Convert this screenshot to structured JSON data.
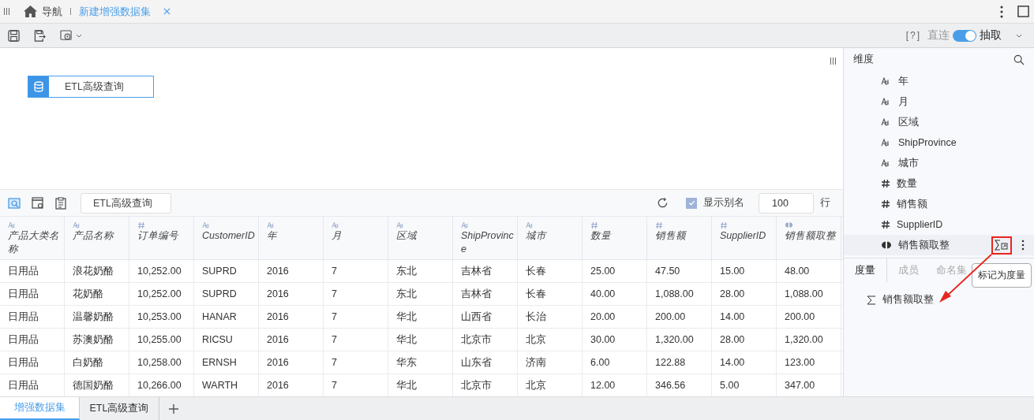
{
  "top_bar": {
    "nav_label": "导航",
    "tabs": [
      {
        "label": "新建增强数据集",
        "selected": true
      }
    ]
  },
  "toolbar": {
    "help": "[?]",
    "mode_left": "直连",
    "mode_on": true,
    "mode_right": "抽取"
  },
  "canvas": {
    "nodes": [
      {
        "label": "ETL高级查询"
      }
    ]
  },
  "preview_toolbar": {
    "node_name": "ETL高级查询",
    "show_alias": {
      "label": "显示别名",
      "checked": true
    },
    "row_limit": "100",
    "row_unit": "行"
  },
  "table": {
    "columns": [
      {
        "kind": "text",
        "label": "产品大类名称"
      },
      {
        "kind": "text",
        "label": "产品名称"
      },
      {
        "kind": "number",
        "label": "订单编号"
      },
      {
        "kind": "text",
        "label": "CustomerID"
      },
      {
        "kind": "text",
        "label": "年"
      },
      {
        "kind": "text",
        "label": "月"
      },
      {
        "kind": "text",
        "label": "区域"
      },
      {
        "kind": "text",
        "label": "ShipProvince"
      },
      {
        "kind": "text",
        "label": "城市"
      },
      {
        "kind": "number",
        "label": "数量"
      },
      {
        "kind": "number",
        "label": "销售额"
      },
      {
        "kind": "number",
        "label": "SupplierID"
      },
      {
        "kind": "calculated",
        "label": "销售额取整"
      }
    ],
    "rows": [
      [
        "日用品",
        "浪花奶酪",
        "10,252.00",
        "SUPRD",
        "2016",
        "7",
        "东北",
        "吉林省",
        "长春",
        "25.00",
        "47.50",
        "15.00",
        "48.00"
      ],
      [
        "日用品",
        "花奶酪",
        "10,252.00",
        "SUPRD",
        "2016",
        "7",
        "东北",
        "吉林省",
        "长春",
        "40.00",
        "1,088.00",
        "28.00",
        "1,088.00"
      ],
      [
        "日用品",
        "温馨奶酪",
        "10,253.00",
        "HANAR",
        "2016",
        "7",
        "华北",
        "山西省",
        "长治",
        "20.00",
        "200.00",
        "14.00",
        "200.00"
      ],
      [
        "日用品",
        "苏澳奶酪",
        "10,255.00",
        "RICSU",
        "2016",
        "7",
        "华北",
        "北京市",
        "北京",
        "30.00",
        "1,320.00",
        "28.00",
        "1,320.00"
      ],
      [
        "日用品",
        "白奶酪",
        "10,258.00",
        "ERNSH",
        "2016",
        "7",
        "华东",
        "山东省",
        "济南",
        "6.00",
        "122.88",
        "14.00",
        "123.00"
      ],
      [
        "日用品",
        "德国奶酪",
        "10,266.00",
        "WARTH",
        "2016",
        "7",
        "华北",
        "北京市",
        "北京",
        "12.00",
        "346.56",
        "5.00",
        "347.00"
      ]
    ]
  },
  "bottom_tabs": [
    {
      "label": "增强数据集",
      "selected": true
    },
    {
      "label": "ETL高级查询",
      "selected": false
    }
  ],
  "dimensions": {
    "title": "维度",
    "items": [
      {
        "kind": "text",
        "label": "年",
        "selected": false
      },
      {
        "kind": "text",
        "label": "月",
        "selected": false
      },
      {
        "kind": "text",
        "label": "区域",
        "selected": false
      },
      {
        "kind": "text",
        "label": "ShipProvince",
        "selected": false
      },
      {
        "kind": "text",
        "label": "城市",
        "selected": false
      },
      {
        "kind": "number",
        "label": "数量",
        "selected": false
      },
      {
        "kind": "number",
        "label": "销售额",
        "selected": false
      },
      {
        "kind": "number",
        "label": "SupplierID",
        "selected": false
      },
      {
        "kind": "calculated",
        "label": "销售额取整",
        "selected": true
      }
    ]
  },
  "lower_tabs": [
    {
      "label": "度量",
      "selected": true
    },
    {
      "label": "成员",
      "selected": false
    },
    {
      "label": "命名集",
      "selected": false
    }
  ],
  "measures": [
    {
      "label": "销售额取整"
    }
  ],
  "tooltip": "标记为度量"
}
